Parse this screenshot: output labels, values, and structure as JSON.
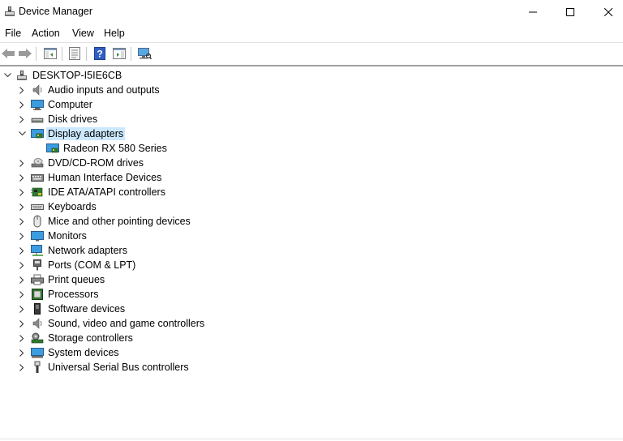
{
  "window": {
    "title": "Device Manager"
  },
  "menu": [
    "File",
    "Action",
    "View",
    "Help"
  ],
  "toolbar": {
    "buttons": [
      "back-icon",
      "forward-icon",
      "show-hide-tree-icon",
      "properties-icon",
      "help-icon",
      "run-action-icon",
      "scan-hardware-icon"
    ]
  },
  "tree": {
    "root": "DESKTOP-I5IE6CB",
    "categories": [
      {
        "label": "Audio inputs and outputs",
        "icon": "speaker-icon",
        "expanded": false
      },
      {
        "label": "Computer",
        "icon": "computer-icon",
        "expanded": false
      },
      {
        "label": "Disk drives",
        "icon": "disk-drive-icon",
        "expanded": false
      },
      {
        "label": "Display adapters",
        "icon": "display-adapter-icon",
        "expanded": true,
        "selected": true,
        "children": [
          "Radeon RX 580 Series"
        ]
      },
      {
        "label": "DVD/CD-ROM drives",
        "icon": "dvd-drive-icon",
        "expanded": false
      },
      {
        "label": "Human Interface Devices",
        "icon": "hid-icon",
        "expanded": false
      },
      {
        "label": "IDE ATA/ATAPI controllers",
        "icon": "ide-controller-icon",
        "expanded": false
      },
      {
        "label": "Keyboards",
        "icon": "keyboard-icon",
        "expanded": false
      },
      {
        "label": "Mice and other pointing devices",
        "icon": "mouse-icon",
        "expanded": false
      },
      {
        "label": "Monitors",
        "icon": "monitor-icon",
        "expanded": false
      },
      {
        "label": "Network adapters",
        "icon": "network-adapter-icon",
        "expanded": false
      },
      {
        "label": "Ports (COM & LPT)",
        "icon": "port-icon",
        "expanded": false
      },
      {
        "label": "Print queues",
        "icon": "printer-icon",
        "expanded": false
      },
      {
        "label": "Processors",
        "icon": "processor-icon",
        "expanded": false
      },
      {
        "label": "Software devices",
        "icon": "software-device-icon",
        "expanded": false
      },
      {
        "label": "Sound, video and game controllers",
        "icon": "sound-controller-icon",
        "expanded": false
      },
      {
        "label": "Storage controllers",
        "icon": "storage-controller-icon",
        "expanded": false
      },
      {
        "label": "System devices",
        "icon": "system-device-icon",
        "expanded": false
      },
      {
        "label": "Universal Serial Bus controllers",
        "icon": "usb-icon",
        "expanded": false
      }
    ]
  },
  "colors": {
    "selection": "#cce8ff",
    "accent": "#3c8dd8"
  }
}
